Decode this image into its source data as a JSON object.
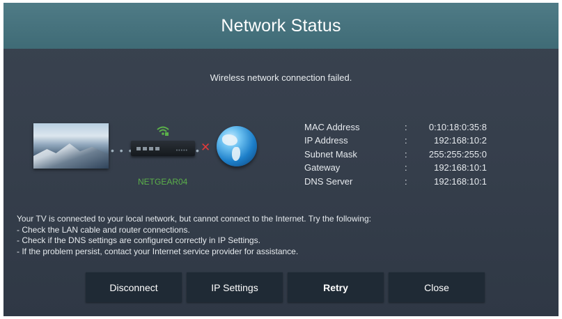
{
  "header": {
    "title": "Network Status"
  },
  "message": "Wireless network connection failed.",
  "diagram": {
    "router_name": "NETGEAR04",
    "status_color": "#e03a3a",
    "wifi_color": "#5bb04a",
    "tv_icon": "tv-icon",
    "router_icon": "router-icon",
    "internet_icon": "globe-icon",
    "connection": "failed"
  },
  "network_info": [
    {
      "label": "MAC Address",
      "value": "0:10:18:0:35:8"
    },
    {
      "label": "IP Address",
      "value": "192:168:10:2"
    },
    {
      "label": "Subnet Mask",
      "value": "255:255:255:0"
    },
    {
      "label": "Gateway",
      "value": "192:168:10:1"
    },
    {
      "label": "DNS Server",
      "value": "192:168:10:1"
    }
  ],
  "instructions": [
    "Your TV is connected to your local network, but cannot connect to the Internet. Try the following:",
    "- Check the LAN cable and router connections.",
    "- Check if the DNS settings are configured correctly in IP Settings.",
    "- If the problem persist, contact your Internet service provider for assistance."
  ],
  "buttons": {
    "disconnect": "Disconnect",
    "ip_settings": "IP Settings",
    "retry": "Retry",
    "close": "Close"
  }
}
